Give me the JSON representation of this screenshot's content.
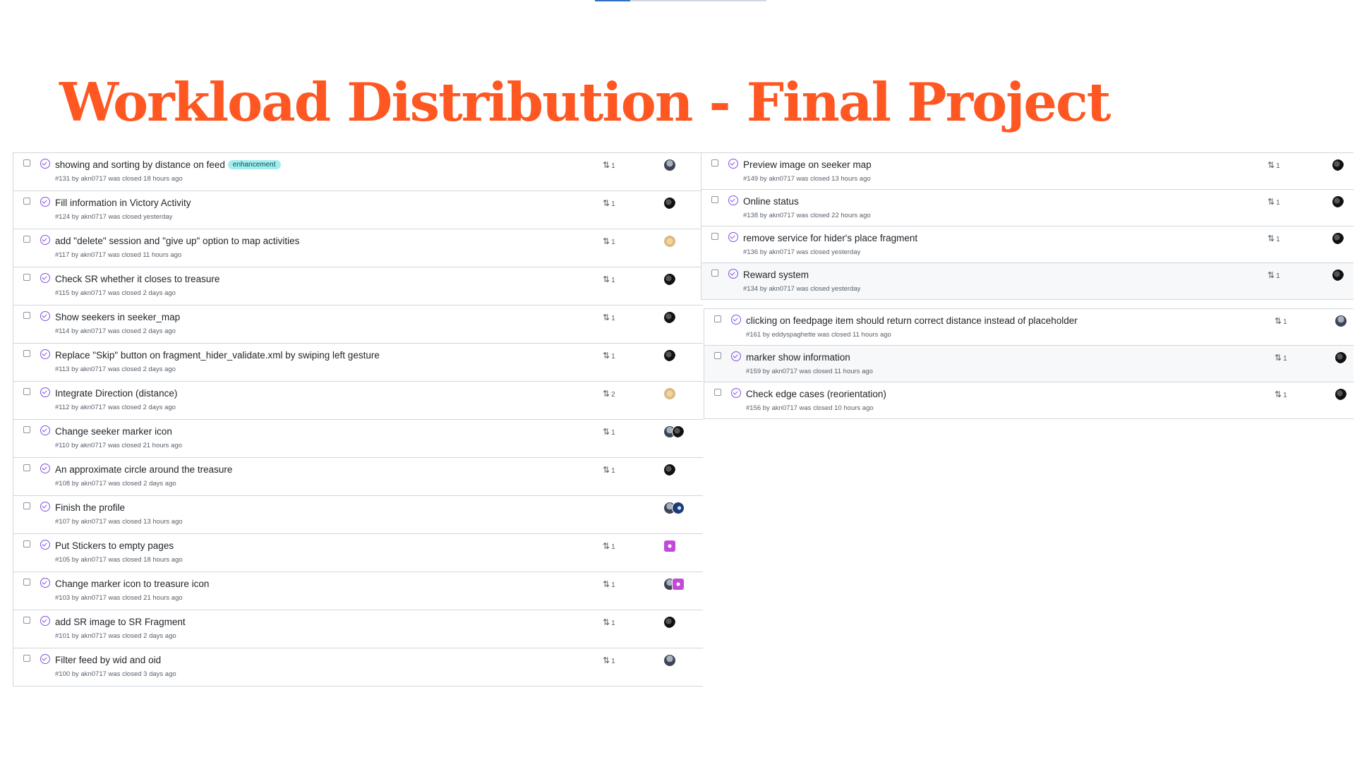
{
  "title": "Workload Distribution - Final Project",
  "colors": {
    "title": "#ff5722",
    "closed_icon": "#8250df",
    "label_bg": "#a2eeef"
  },
  "icons": {
    "closed": "issue-closed-icon",
    "pr": "git-pull-request-icon"
  },
  "left_issues": [
    {
      "title": "showing and sorting by distance on feed",
      "label": "enhancement",
      "meta": "#131 by akn0717 was closed 18 hours ago",
      "pr_count": "1",
      "avatars": [
        "gray"
      ]
    },
    {
      "title": "Fill information in Victory Activity",
      "meta": "#124 by akn0717 was closed yesterday",
      "pr_count": "1",
      "avatars": [
        "dark"
      ]
    },
    {
      "title": "add \"delete\" session and \"give up\" option to map activities",
      "meta": "#117 by akn0717 was closed 11 hours ago",
      "pr_count": "1",
      "avatars": [
        "tan"
      ]
    },
    {
      "title": "Check SR whether it closes to treasure",
      "meta": "#115 by akn0717 was closed 2 days ago",
      "pr_count": "1",
      "avatars": [
        "dark"
      ]
    },
    {
      "title": "Show seekers in seeker_map",
      "meta": "#114 by akn0717 was closed 2 days ago",
      "pr_count": "1",
      "avatars": [
        "dark"
      ]
    },
    {
      "title": "Replace \"Skip\" button on fragment_hider_validate.xml by swiping left gesture",
      "meta": "#113 by akn0717 was closed 2 days ago",
      "pr_count": "1",
      "avatars": [
        "dark"
      ]
    },
    {
      "title": "Integrate Direction (distance)",
      "meta": "#112 by akn0717 was closed 2 days ago",
      "pr_count": "2",
      "avatars": [
        "tan"
      ]
    },
    {
      "title": "Change seeker marker icon",
      "meta": "#110 by akn0717 was closed 21 hours ago",
      "pr_count": "1",
      "avatars": [
        "gray",
        "dark"
      ]
    },
    {
      "title": "An approximate circle around the treasure",
      "meta": "#108 by akn0717 was closed 2 days ago",
      "pr_count": "1",
      "avatars": [
        "dark"
      ]
    },
    {
      "title": "Finish the profile",
      "meta": "#107 by akn0717 was closed 13 hours ago",
      "pr_count": "",
      "avatars": [
        "gray",
        "blue"
      ]
    },
    {
      "title": "Put Stickers to empty pages",
      "meta": "#105 by akn0717 was closed 18 hours ago",
      "pr_count": "1",
      "avatars": [
        "pink"
      ]
    },
    {
      "title": "Change marker icon to treasure icon",
      "meta": "#103 by akn0717 was closed 21 hours ago",
      "pr_count": "1",
      "avatars": [
        "gray",
        "pink"
      ]
    },
    {
      "title": "add SR image to SR Fragment",
      "meta": "#101 by akn0717 was closed 2 days ago",
      "pr_count": "1",
      "avatars": [
        "dark"
      ]
    },
    {
      "title": "Filter feed by wid and oid",
      "meta": "#100 by akn0717 was closed 3 days ago",
      "pr_count": "1",
      "avatars": [
        "gray"
      ]
    }
  ],
  "right_issues_a": [
    {
      "title": "Preview image on seeker map",
      "meta": "#149 by akn0717 was closed 13 hours ago",
      "pr_count": "1",
      "avatars": [
        "dark"
      ]
    },
    {
      "title": "Online status",
      "meta": "#138 by akn0717 was closed 22 hours ago",
      "pr_count": "1",
      "avatars": [
        "dark"
      ]
    },
    {
      "title": "remove service for hider's place fragment",
      "meta": "#136 by akn0717 was closed yesterday",
      "pr_count": "1",
      "avatars": [
        "dark"
      ]
    },
    {
      "title": "Reward system",
      "meta": "#134 by akn0717 was closed yesterday",
      "pr_count": "1",
      "avatars": [
        "dark"
      ]
    }
  ],
  "right_issues_b": [
    {
      "title": "clicking on feedpage item should return correct distance instead of placeholder",
      "meta": "#161 by eddyspaghette was closed 11 hours ago",
      "pr_count": "1",
      "avatars": [
        "gray"
      ]
    },
    {
      "title": "marker show information",
      "meta": "#159 by akn0717 was closed 11 hours ago",
      "pr_count": "1",
      "avatars": [
        "dark"
      ]
    },
    {
      "title": "Check edge cases (reorientation)",
      "meta": "#156 by akn0717 was closed 10 hours ago",
      "pr_count": "1",
      "avatars": [
        "dark"
      ]
    }
  ]
}
